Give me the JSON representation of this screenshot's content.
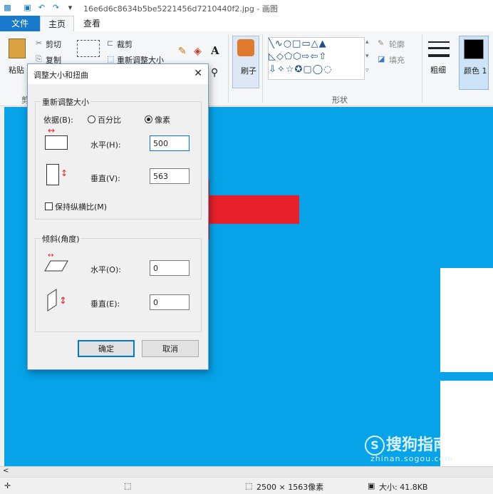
{
  "window": {
    "title": "16e6d6c8634b5be5221456d7210440f2.jpg - 画图"
  },
  "tabs": [
    "文件",
    "主页",
    "查看"
  ],
  "ribbon": {
    "paste": "粘贴",
    "cut": "剪切",
    "copy": "复制",
    "crop": "裁剪",
    "resize": "重新调整大小",
    "brush": "刷子",
    "shapes_group": "形状",
    "outline": "轮廓",
    "fill": "填充",
    "size": "粗细",
    "color1": "颜色 1",
    "partial_group": "剪"
  },
  "colors": {
    "accent": "#1979ca",
    "canvas": "#06a3e8",
    "arrow": "#e8202a"
  },
  "dialog": {
    "title": "调整大小和扭曲",
    "resize_group": "重新调整大小",
    "by_label": "依据(B):",
    "percent_option": "百分比",
    "pixels_option": "像素",
    "horizontal_label": "水平(H):",
    "horizontal_value": "500",
    "vertical_label": "垂直(V):",
    "vertical_value": "563",
    "keep_ratio": "保持纵横比(M)",
    "skew_group": "倾斜(角度)",
    "skew_h_label": "水平(O):",
    "skew_h_value": "0",
    "skew_v_label": "垂直(E):",
    "skew_v_value": "0",
    "ok": "确定",
    "cancel": "取消"
  },
  "status": {
    "dimensions": "2500 × 1563像素",
    "size": "大小: 41.8KB"
  },
  "watermark": {
    "brand": "搜狗指南",
    "url": "zhinan.sogou.com"
  }
}
